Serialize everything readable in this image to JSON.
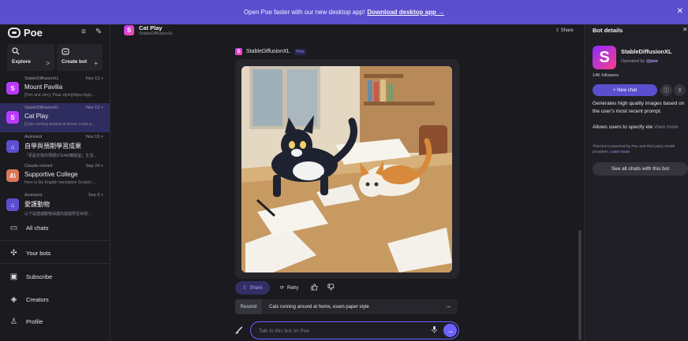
{
  "banner": {
    "text": "Open Poe faster with our new desktop app!",
    "link": "Download desktop app →",
    "close": "✕"
  },
  "sidebar": {
    "brand": "Poe",
    "menu_icon": "≡",
    "compose_icon": "✎",
    "explore_label": "Explore",
    "explore_arrow": ">",
    "create_label": "Create bot",
    "create_plus": "+",
    "chats": [
      {
        "bot": "StableDiffusionXL",
        "date": "Nov 13 >",
        "title": "Mount Pavilia",
        "snippet": "[Tom and Jerry, Pixar style](https://sgh...",
        "avatar": "S",
        "color": "#b93bff"
      },
      {
        "bot": "StableDiffusionXL",
        "date": "Nov 13 >",
        "title": "Cat Play",
        "snippet": "[Cats running around at home, exam p...",
        "avatar": "S",
        "color": "#b93bff"
      },
      {
        "bot": "Assistant",
        "date": "Nov 19 >",
        "title": "自學與預期學習成果",
        "snippet": "「更設定我的預期STEAM實驗室」生活...",
        "avatar": "⌂",
        "color": "#5b4fcf"
      },
      {
        "bot": "Claude-instant",
        "date": "Sep 24 >",
        "title": "Supportive College",
        "snippet": "Here is the English translation Scratch ...",
        "avatar": "A\\",
        "color": "#d97757"
      },
      {
        "bot": "Assistant",
        "date": "Sep 3 >",
        "title": "愛護動物",
        "snippet": "以下是建議動物保護的建議學習目標:...",
        "avatar": "⌂",
        "color": "#5b4fcf"
      }
    ],
    "nav": [
      {
        "label": "All chats",
        "icon": "▭"
      },
      {
        "label": "Your bots",
        "icon": "✣"
      },
      {
        "label": "Subscribe",
        "icon": "▣"
      },
      {
        "label": "Creators",
        "icon": "◈"
      },
      {
        "label": "Profile",
        "icon": "♙"
      }
    ]
  },
  "chat": {
    "title": "Cat Play",
    "subtitle": "StableDiffusionXL",
    "share": "⇪ Share",
    "bot_name": "StableDiffusionXL",
    "bot_badge": "Poe",
    "share_btn": "Share",
    "retry_btn": "Retry",
    "thumb_up": "👍",
    "thumb_down": "👎",
    "resend_label": "Resend",
    "resend_text": "Cats running around at home, exam paper style",
    "resend_arrow": "→",
    "composer_placeholder": "Talk to this bot on Poe"
  },
  "details": {
    "title": "Bot details",
    "close": "✕",
    "name": "StableDiffusionXL",
    "operated_by": "Operated by",
    "operator": "@poe",
    "followers": "14K followers",
    "new_chat": "+ New chat",
    "description": "Generates high quality images based on the user's most recent prompt.",
    "allows": "Allows users to specify ele",
    "view_more": "View more",
    "powered": "This bot is powered by Poe and third party model providers.",
    "learn_more": "Learn more",
    "see_all": "See all chats with this bot"
  }
}
